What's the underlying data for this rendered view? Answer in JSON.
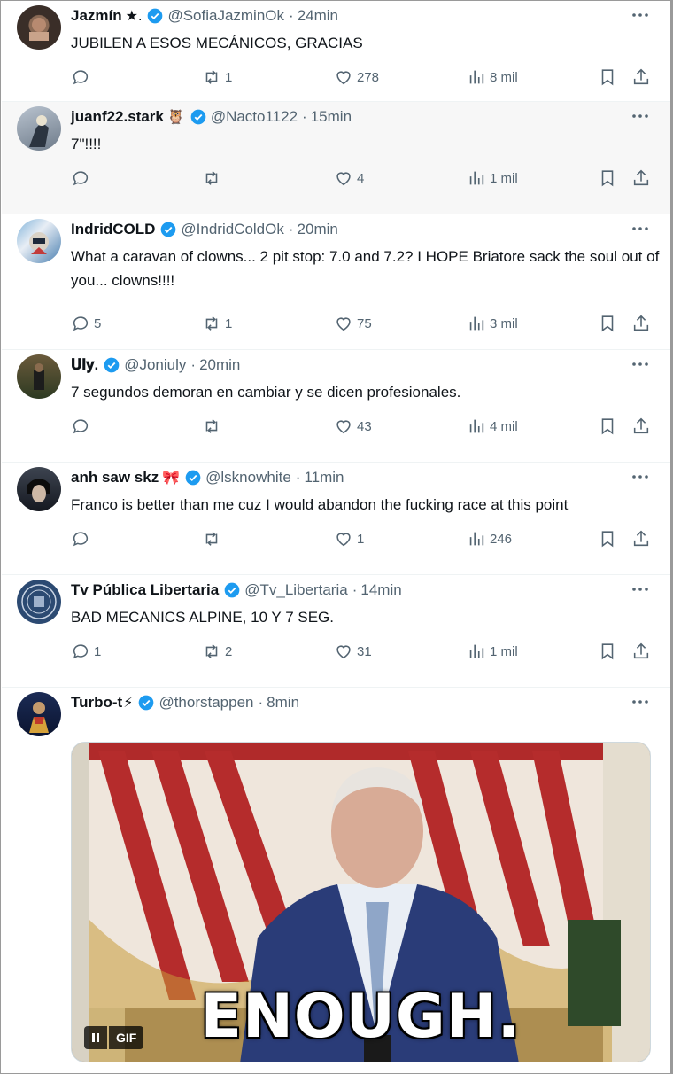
{
  "colors": {
    "verified": "#1d9bf0",
    "muted": "#536471",
    "text": "#0f1419",
    "hover_bg": "#f7f7f7"
  },
  "tweets": [
    {
      "name": "Jazmín",
      "emoji": "★.",
      "handle": "@SofiaJazminOk",
      "time": "24min",
      "text": "JUBILEN A ESOS MECÁNICOS, GRACIAS",
      "replies": "",
      "retweets": "1",
      "likes": "278",
      "views": "8 mil"
    },
    {
      "name": "juanf22.stark",
      "emoji": "🦉",
      "handle": "@Nacto1122",
      "time": "15min",
      "text": "7\"!!!!",
      "replies": "",
      "retweets": "",
      "likes": "4",
      "views": "1 mil"
    },
    {
      "name": "IndridCOLD",
      "emoji": "",
      "handle": "@IndridColdOk",
      "time": "20min",
      "text": "What a caravan of clowns... 2 pit stop: 7.0 and 7.2? I HOPE Briatore sack the soul out of you... clowns!!!!",
      "replies": "5",
      "retweets": "1",
      "likes": "75",
      "views": "3 mil"
    },
    {
      "name": "𝐔𝐥𝐲.",
      "emoji": "",
      "handle": "@Joniuly",
      "time": "20min",
      "text": "7 segundos demoran en cambiar y se dicen profesionales.",
      "replies": "",
      "retweets": "",
      "likes": "43",
      "views": "4 mil"
    },
    {
      "name": "anh saw skz",
      "emoji": "🎀",
      "handle": "@lsknowhite",
      "time": "11min",
      "text": "Franco is better than me cuz I would abandon the fucking race at this point",
      "replies": "",
      "retweets": "",
      "likes": "1",
      "views": "246"
    },
    {
      "name": "Tv Pública Libertaria",
      "emoji": "",
      "handle": "@Tv_Libertaria",
      "time": "14min",
      "text": "BAD MECANICS ALPINE, 10 Y 7 SEG.",
      "replies": "1",
      "retweets": "2",
      "likes": "31",
      "views": "1 mil"
    },
    {
      "name": "Turbo-t",
      "emoji": "⚡",
      "handle": "@thorstappen",
      "time": "8min",
      "text": "",
      "media_caption": "ENOUGH.",
      "media_badge": "GIF"
    }
  ]
}
